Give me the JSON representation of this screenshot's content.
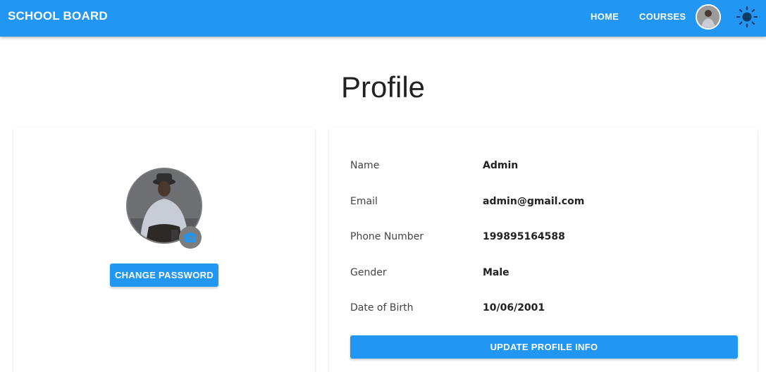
{
  "appbar": {
    "brand": "SCHOOL BOARD",
    "nav": {
      "home": "HOME",
      "courses": "COURSES"
    },
    "avatar_icon": "user-avatar-photo",
    "theme_icon": "sun-icon"
  },
  "page": {
    "title": "Profile"
  },
  "left_card": {
    "avatar_icon": "profile-photo",
    "camera_icon": "camera-icon",
    "change_password_label": "CHANGE PASSWORD"
  },
  "profile": {
    "fields": [
      {
        "label": "Name",
        "value": "Admin"
      },
      {
        "label": "Email",
        "value": "admin@gmail.com"
      },
      {
        "label": "Phone Number",
        "value": "199895164588"
      },
      {
        "label": "Gender",
        "value": "Male"
      },
      {
        "label": "Date of Birth",
        "value": "10/06/2001"
      }
    ],
    "update_label": "UPDATE PROFILE INFO"
  },
  "colors": {
    "primary": "#2196f3",
    "dark_icon": "#0d3b66"
  }
}
